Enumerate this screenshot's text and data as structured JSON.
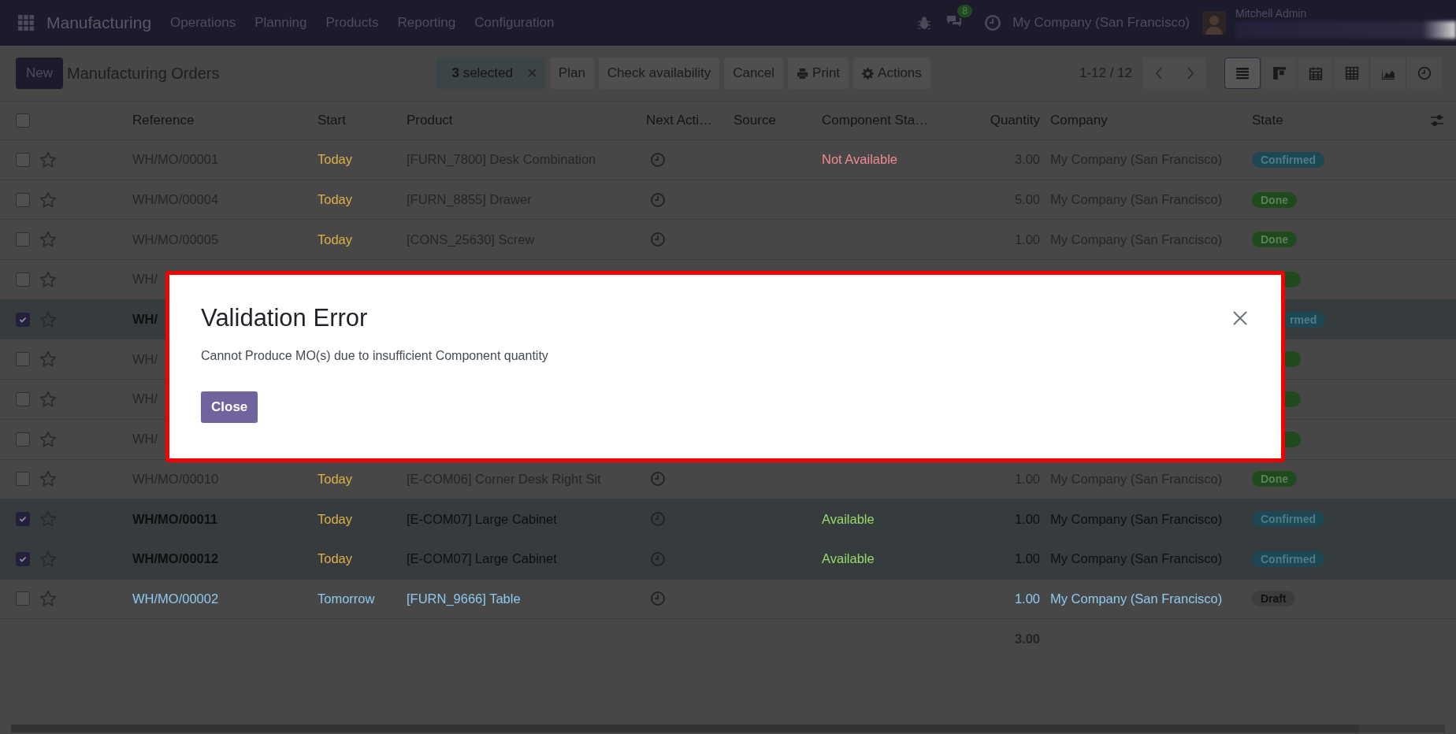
{
  "navbar": {
    "app_name": "Manufacturing",
    "menu": [
      "Operations",
      "Planning",
      "Products",
      "Reporting",
      "Configuration"
    ],
    "messages_count": "8",
    "company": "My Company (San Francisco)",
    "user": "Mitchell Admin"
  },
  "control_panel": {
    "new_button": "New",
    "title": "Manufacturing Orders",
    "selection": "**3** selected",
    "clear_selection": "×",
    "actions": [
      {
        "label": "Plan",
        "kind": "plain"
      },
      {
        "label": "Check availability",
        "kind": "plain"
      },
      {
        "label": "Cancel",
        "kind": "plain"
      },
      {
        "label": "Print",
        "kind": "print"
      },
      {
        "label": "Actions",
        "kind": "gear"
      }
    ],
    "pager": "1-12 / 12",
    "views": [
      {
        "kind": "list",
        "selected": true
      },
      {
        "kind": "kanban",
        "selected": false
      },
      {
        "kind": "calendar",
        "selected": false
      },
      {
        "kind": "pivot",
        "selected": false
      },
      {
        "kind": "graph",
        "selected": false
      },
      {
        "kind": "activity",
        "selected": false
      }
    ]
  },
  "table": {
    "header_checked": false,
    "columns": [
      "Reference",
      "Start",
      "Product",
      "Next Acti…",
      "Source",
      "Component Sta…",
      "Quantity",
      "Company",
      "State"
    ],
    "rows": [
      {
        "selected": false,
        "kind": "normal",
        "reference": "WH/MO/00001",
        "start": {
          "text": "Today",
          "kind": "today"
        },
        "product": "[FURN_7800] Desk Combination",
        "component_status": {
          "text": "Not Available",
          "kind": "unavailable"
        },
        "quantity": "3.00",
        "company": "My Company (San Francisco)",
        "state": {
          "kind": "confirmed",
          "label": "Confirmed"
        }
      },
      {
        "selected": false,
        "kind": "normal",
        "reference": "WH/MO/00004",
        "start": {
          "text": "Today",
          "kind": "today"
        },
        "product": "[FURN_8855] Drawer",
        "quantity": "5.00",
        "company": "My Company (San Francisco)",
        "state": {
          "kind": "done",
          "label": "Done"
        }
      },
      {
        "selected": false,
        "kind": "normal",
        "reference": "WH/MO/00005",
        "start": {
          "text": "Today",
          "kind": "today"
        },
        "product": "[CONS_25630] Screw",
        "quantity": "1.00",
        "company": "My Company (San Francisco)",
        "state": {
          "kind": "done",
          "label": "Done"
        }
      },
      {
        "selected": false,
        "kind": "normal",
        "reference": "WH/",
        "state": {
          "kind": "done"
        }
      },
      {
        "selected": true,
        "kind": "normal",
        "reference": "WH/",
        "state": {
          "kind": "confirmed",
          "label": "rmed"
        }
      },
      {
        "selected": false,
        "kind": "normal",
        "reference": "WH/",
        "state": {
          "kind": "done"
        }
      },
      {
        "selected": false,
        "kind": "normal",
        "reference": "WH/",
        "state": {
          "kind": "done"
        }
      },
      {
        "selected": false,
        "kind": "normal",
        "reference": "WH/",
        "state": {
          "kind": "done"
        }
      },
      {
        "selected": false,
        "kind": "normal",
        "reference": "WH/MO/00010",
        "start": {
          "text": "Today",
          "kind": "today"
        },
        "product": "[E-COM06] Corner Desk Right Sit",
        "quantity": "1.00",
        "company": "My Company (San Francisco)",
        "state": {
          "kind": "done",
          "label": "Done"
        }
      },
      {
        "selected": true,
        "kind": "normal",
        "reference": "WH/MO/00011",
        "start": {
          "text": "Today",
          "kind": "today"
        },
        "product": "[E-COM07] Large Cabinet",
        "component_status": {
          "text": "Available",
          "kind": "available"
        },
        "quantity": "1.00",
        "company": "My Company (San Francisco)",
        "state": {
          "kind": "confirmed",
          "label": "Confirmed"
        }
      },
      {
        "selected": true,
        "kind": "normal",
        "reference": "WH/MO/00012",
        "start": {
          "text": "Today",
          "kind": "today"
        },
        "product": "[E-COM07] Large Cabinet",
        "component_status": {
          "text": "Available",
          "kind": "available"
        },
        "quantity": "1.00",
        "company": "My Company (San Francisco)",
        "state": {
          "kind": "confirmed",
          "label": "Confirmed"
        }
      },
      {
        "selected": false,
        "kind": "draft",
        "reference": "WH/MO/00002",
        "start": {
          "text": "Tomorrow",
          "kind": "later"
        },
        "product": "[FURN_9666] Table",
        "quantity": "1.00",
        "company": "My Company (San Francisco)",
        "state": {
          "kind": "draft",
          "label": "Draft"
        }
      }
    ],
    "total_quantity": "3.00"
  },
  "dialog": {
    "title": "Validation Error",
    "message": "Cannot Produce MO(s) due to insufficient Component quantity",
    "button": "Close",
    "highlighted": true
  }
}
